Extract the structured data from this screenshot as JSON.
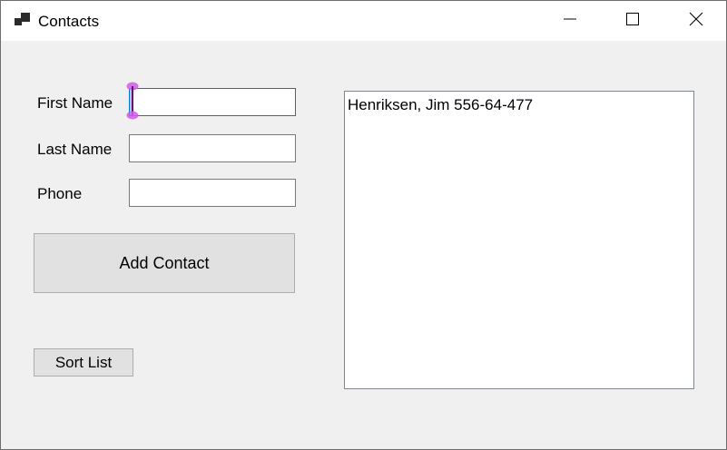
{
  "window": {
    "title": "Contacts",
    "icon": "form-icon",
    "controls": {
      "minimize_icon": "minimize-icon",
      "maximize_icon": "maximize-icon",
      "close_icon": "close-icon"
    }
  },
  "form": {
    "first_name_label": "First Name",
    "last_name_label": "Last Name",
    "phone_label": "Phone",
    "first_name_value": "",
    "last_name_value": "",
    "phone_value": "",
    "add_button_label": "Add Contact",
    "sort_button_label": "Sort List"
  },
  "contacts_list": {
    "items": [
      "Henriksen, Jim 556-64-477"
    ]
  },
  "colors": {
    "focus_border": "#0078d7",
    "caret_marker": "#d15ce8"
  }
}
